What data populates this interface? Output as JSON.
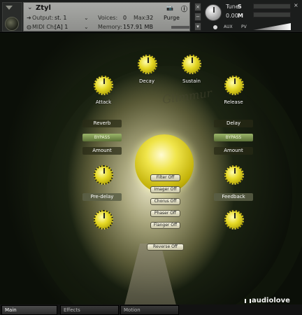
{
  "header": {
    "instrument_name": "Ztyl",
    "output_label": "Output:",
    "output_value": "st. 1",
    "midi_label": "MIDI Ch:",
    "midi_value": "[A] 1",
    "voices_label": "Voices:",
    "voices_value": "0",
    "max_label": "Max:",
    "max_value": "32",
    "purge_label": "Purge",
    "memory_label": "Memory:",
    "memory_value": "157.91 MB",
    "tune_label": "Tune",
    "tune_value": "0.00",
    "s_label": "S",
    "m_label": "M",
    "aux_label": "AUX",
    "pv_label": "PV"
  },
  "main": {
    "emblem": "Glimmur",
    "knobs": {
      "attack": "Attack",
      "decay": "Decay",
      "sustain": "Sustain",
      "release": "Release",
      "predelay": "Pre-delay",
      "feedback": "Feedback"
    },
    "reverb": {
      "title": "Reverb",
      "toggle": "BYPASS",
      "amount": "Amount"
    },
    "delay": {
      "title": "Delay",
      "toggle": "BYPASS",
      "amount": "Amount"
    },
    "fx_buttons": [
      "Filter Off",
      "Imager Off",
      "Chorus Off",
      "Phaser Off",
      "Flanger Off"
    ],
    "reverse_button": "Reverse Off"
  },
  "tabs": [
    "Main",
    "Effects",
    "Motion"
  ],
  "watermark": "audiolove",
  "colors": {
    "accent_knob": "#e5d824",
    "header_panel": "#9a9b98"
  }
}
